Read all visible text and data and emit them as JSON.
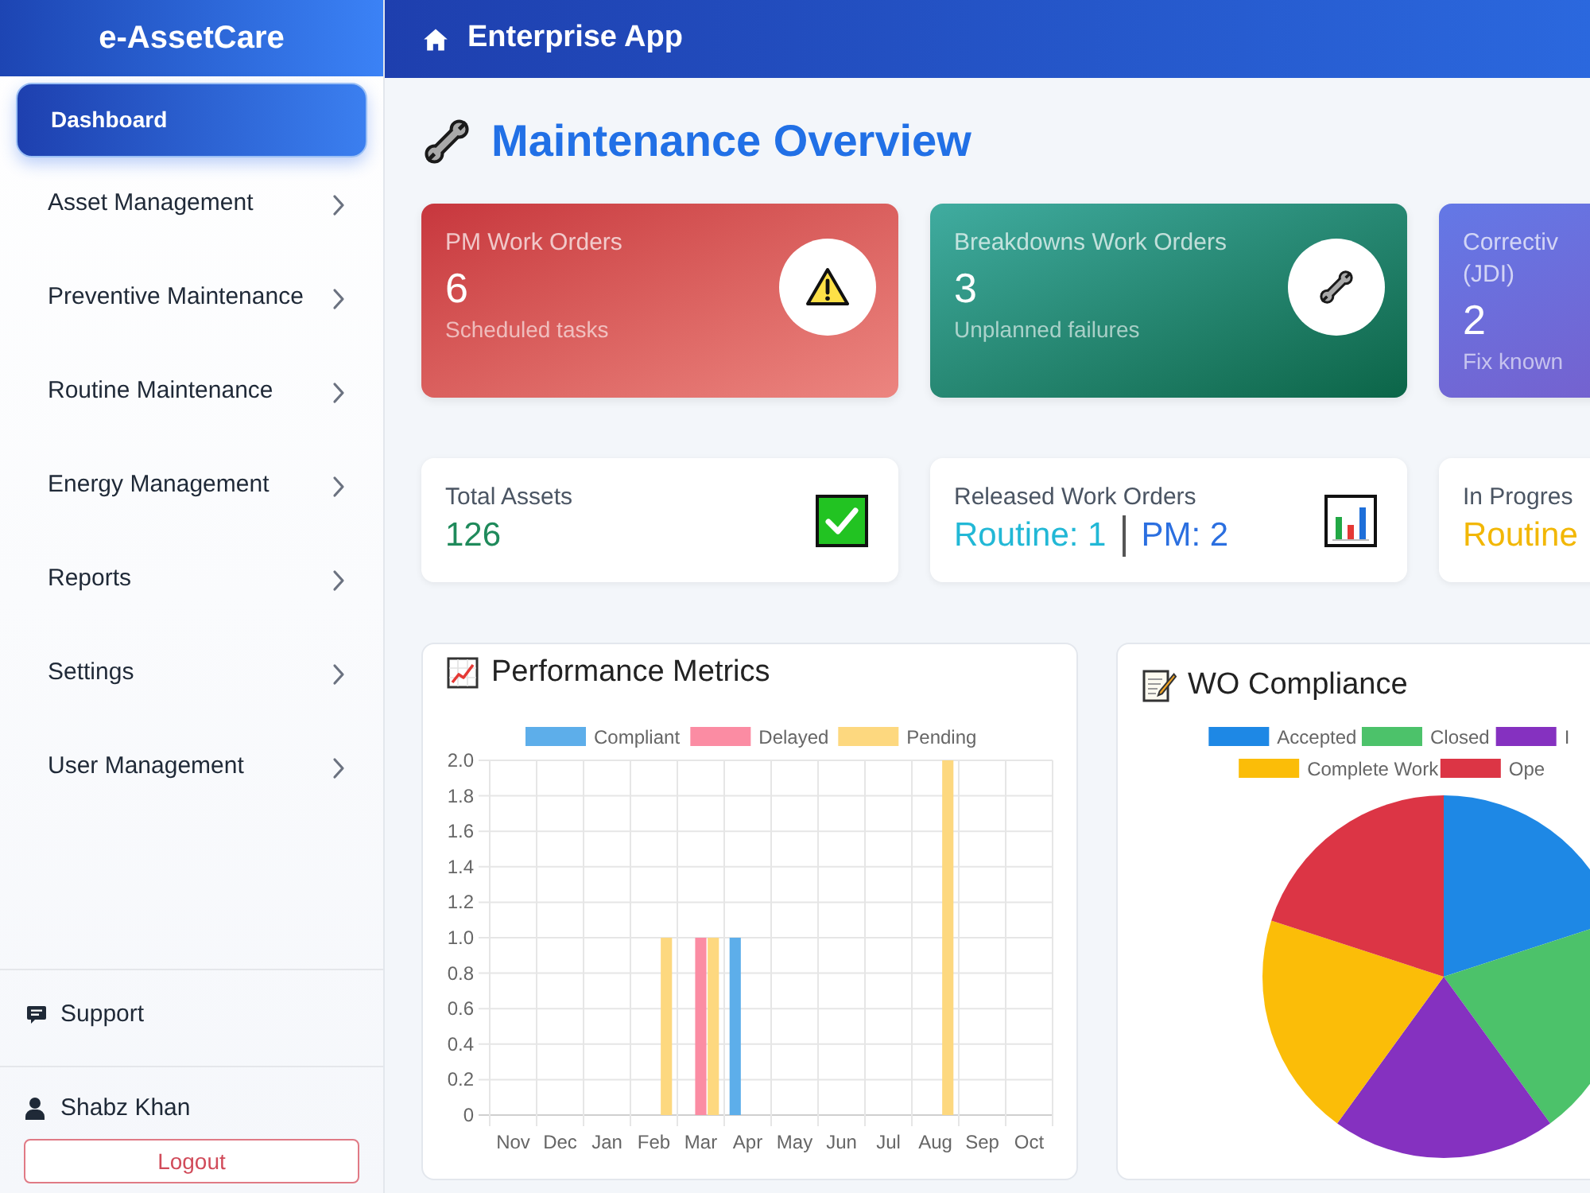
{
  "sidebar": {
    "brand": "e-AssetCare",
    "items": [
      {
        "label": "Dashboard",
        "kind": "link",
        "selected": true
      },
      {
        "label": "Asset Management",
        "kind": "menu",
        "selected": false
      },
      {
        "label": "Preventive Maintenance",
        "kind": "menu",
        "selected": false
      },
      {
        "label": "Routine Maintenance",
        "kind": "menu",
        "selected": false
      },
      {
        "label": "Energy Management",
        "kind": "menu",
        "selected": false
      },
      {
        "label": "Reports",
        "kind": "menu",
        "selected": false
      },
      {
        "label": "Settings",
        "kind": "menu",
        "selected": false
      },
      {
        "label": "User Management",
        "kind": "menu",
        "selected": false
      }
    ],
    "support": "Support",
    "user": "Shabz Khan",
    "logout": "Logout"
  },
  "header": {
    "title": "Enterprise App"
  },
  "page_title": "Maintenance Overview",
  "summary_cards": [
    {
      "kind": "alert",
      "label": "PM Work Orders",
      "value": "6",
      "caption": "Scheduled tasks"
    },
    {
      "kind": "repair",
      "label": "Breakdowns Work Orders",
      "value": "3",
      "caption": "Unplanned failures"
    },
    {
      "kind": "fix",
      "label": "Correctiv\n(JDI)",
      "value": "2",
      "caption": "Fix known"
    }
  ],
  "stat_cards": [
    {
      "label": "Total Assets",
      "values": [
        {
          "text": "126",
          "color": "#1f8a5b"
        }
      ]
    },
    {
      "label": "Released Work Orders",
      "values": [
        {
          "text": "Routine: 1",
          "color": "#22b8d6"
        },
        {
          "text": "PM: 2",
          "color": "#2b6fe0"
        }
      ]
    },
    {
      "label": "In Progres",
      "values": [
        {
          "text": "Routine",
          "color": "#f2b705"
        }
      ]
    }
  ],
  "charts": [
    {
      "title": "Performance Metrics",
      "chart_data": {
        "type": "bar",
        "categories": [
          "Nov",
          "Dec",
          "Jan",
          "Feb",
          "Mar",
          "Apr",
          "May",
          "Jun",
          "Jul",
          "Aug",
          "Sep",
          "Oct"
        ],
        "series": [
          {
            "name": "Compliant",
            "color": "#5daeea",
            "values": [
              0,
              0,
              0,
              0,
              0,
              1,
              0,
              0,
              0,
              0,
              0,
              0
            ]
          },
          {
            "name": "Delayed",
            "color": "#fb8ca3",
            "values": [
              0,
              0,
              0,
              0,
              1,
              0,
              0,
              0,
              0,
              0,
              0,
              0
            ]
          },
          {
            "name": "Pending",
            "color": "#fdd87f",
            "values": [
              0,
              0,
              0,
              1,
              1,
              0,
              0,
              0,
              0,
              2,
              0,
              0
            ]
          }
        ],
        "ylim": [
          0,
          2
        ],
        "yticks": [
          0,
          0.2,
          0.4,
          0.6,
          0.8,
          {
            "value": 1,
            "label": "1.0"
          },
          1.2,
          1.4,
          1.6,
          1.8,
          {
            "value": 2,
            "label": "2.0"
          }
        ],
        "grid": true,
        "legend": "top"
      }
    },
    {
      "title": "WO Compliance",
      "chart_data": {
        "type": "pie",
        "categories": [
          "Accepted",
          "Closed",
          "I",
          "Complete Work",
          "Ope"
        ],
        "values": [
          20,
          20,
          20,
          20,
          20
        ],
        "colors": [
          "#1e88e5",
          "#4cc26a",
          "#8531c0",
          "#fbbd08",
          "#dc3545"
        ],
        "legend": "top"
      }
    }
  ]
}
